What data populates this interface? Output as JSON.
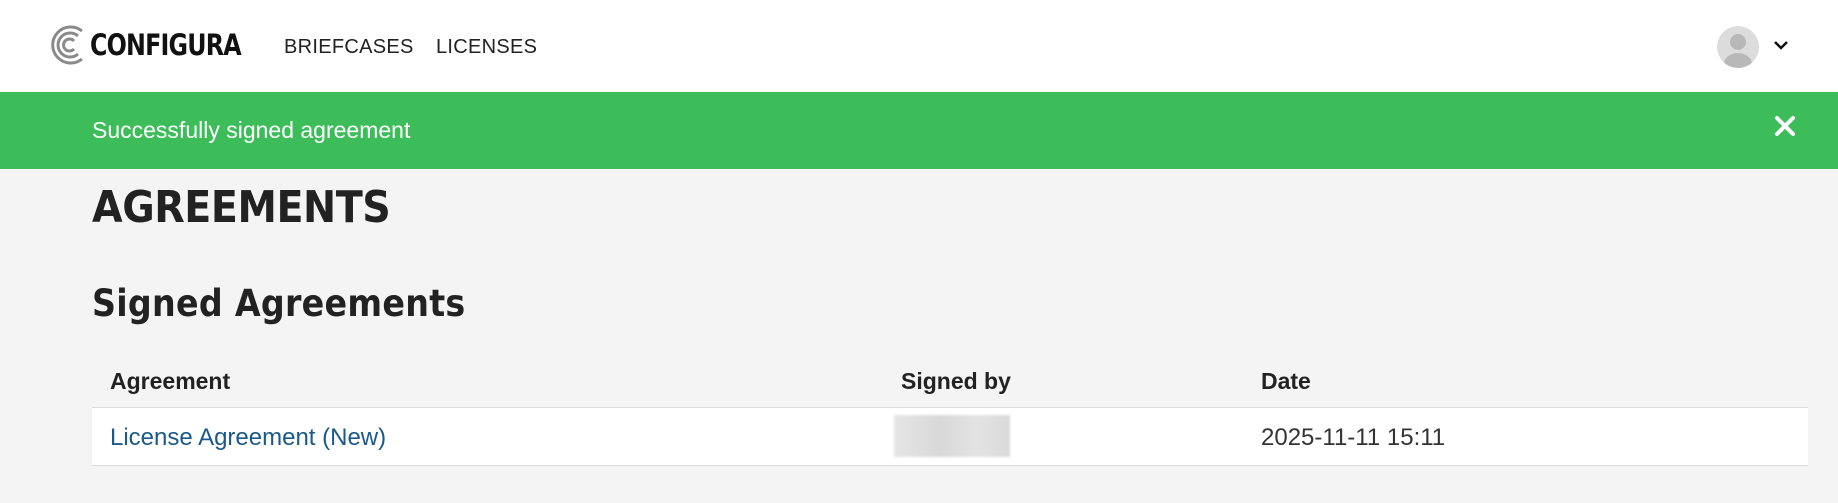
{
  "header": {
    "logo_text": "CONFIGURA",
    "nav": [
      {
        "label": "BRIEFCASES"
      },
      {
        "label": "LICENSES"
      }
    ],
    "icons": {
      "avatar": "user-avatar-icon",
      "menu": "chevron-down-icon"
    }
  },
  "banner": {
    "message": "Successfully signed agreement",
    "color": "#3cbd5a",
    "close_icon": "close-icon"
  },
  "page": {
    "title": "AGREEMENTS",
    "section_title": "Signed Agreements"
  },
  "table": {
    "columns": [
      "Agreement",
      "Signed by",
      "Date"
    ],
    "rows": [
      {
        "agreement": "License Agreement (New)",
        "signed_by": "",
        "date": "2025-11-11 15:11"
      }
    ]
  },
  "colors": {
    "link": "#1a5a8a",
    "background": "#f4f4f4"
  }
}
